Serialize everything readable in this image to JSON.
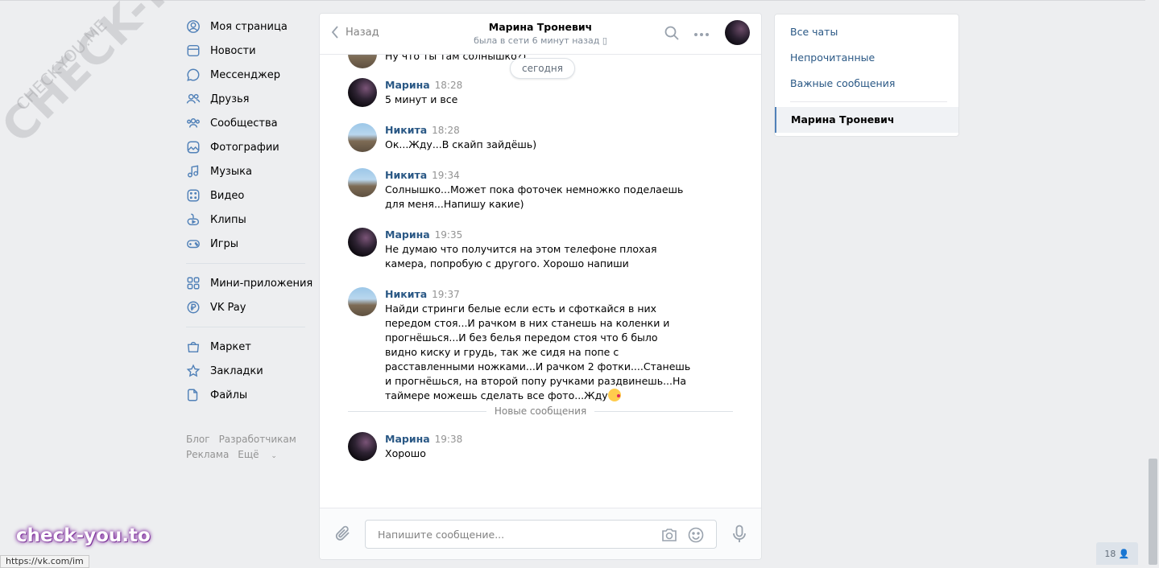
{
  "watermark": {
    "big": "CHECK-YOU.ME",
    "small": "CHECK-YOU.ME",
    "bottom": "check-you.to"
  },
  "status_bar_url": "https://vk.com/im",
  "nav": {
    "items": [
      {
        "label": "Моя страница",
        "icon": "user-circle-icon"
      },
      {
        "label": "Новости",
        "icon": "newspaper-icon"
      },
      {
        "label": "Мессенджер",
        "icon": "message-bubble-icon"
      },
      {
        "label": "Друзья",
        "icon": "friends-icon"
      },
      {
        "label": "Сообщества",
        "icon": "communities-icon"
      },
      {
        "label": "Фотографии",
        "icon": "photo-icon"
      },
      {
        "label": "Музыка",
        "icon": "music-note-icon"
      },
      {
        "label": "Видео",
        "icon": "video-icon"
      },
      {
        "label": "Клипы",
        "icon": "clips-icon"
      },
      {
        "label": "Игры",
        "icon": "gamepad-icon"
      }
    ],
    "items2": [
      {
        "label": "Мини-приложения",
        "icon": "grid-apps-icon"
      },
      {
        "label": "VK Pay",
        "icon": "ruble-coin-icon"
      }
    ],
    "items3": [
      {
        "label": "Маркет",
        "icon": "shopping-bag-icon"
      },
      {
        "label": "Закладки",
        "icon": "star-icon"
      },
      {
        "label": "Файлы",
        "icon": "file-icon"
      }
    ],
    "footer": {
      "blog": "Блог",
      "devs": "Разработчикам",
      "ads": "Реклама",
      "more": "Ещё"
    }
  },
  "chat": {
    "back_label": "Назад",
    "peer_name": "Марина Троневич",
    "peer_status": "была в сети 6 минут назад",
    "clipped_text": "Ну что ты там солнышко?)",
    "date_pill": "сегодня",
    "messages": [
      {
        "author": "Марина",
        "time": "18:28",
        "text": "5 минут и все"
      },
      {
        "author": "Никита",
        "time": "18:28",
        "text": "Ок...Жду...В скайп зайдёшь)"
      },
      {
        "author": "Никита",
        "time": "19:34",
        "text": "Солнышко...Может пока фоточек немножко поделаешь для меня...Напишу какие)"
      },
      {
        "author": "Марина",
        "time": "19:35",
        "text": "Не думаю что получится на этом телефоне плохая камера, попробую с другого. Хорошо напиши"
      },
      {
        "author": "Никита",
        "time": "19:37",
        "text": "Найди стринги белые если есть и сфоткайся в них передом стоя...И рачком в них станешь на коленки и прогнёшься...И без белья передом стоя что б было видно киску и грудь, так же сидя на попе с расставленными ножками...И рачком 2 фотки....Станешь и прогнёшься, на второй попу ручками раздвинешь...На таймере можешь сделать все фото...Жду"
      },
      {
        "author": "Марина",
        "time": "19:38",
        "text": "Хорошо"
      }
    ],
    "new_messages_label": "Новые сообщения",
    "composer_placeholder": "Напишите сообщение..."
  },
  "right_panel": {
    "all_chats": "Все чаты",
    "unread": "Непрочитанные",
    "important": "Важные сообщения",
    "active_chat": "Марина Троневич"
  },
  "online_count": "18"
}
